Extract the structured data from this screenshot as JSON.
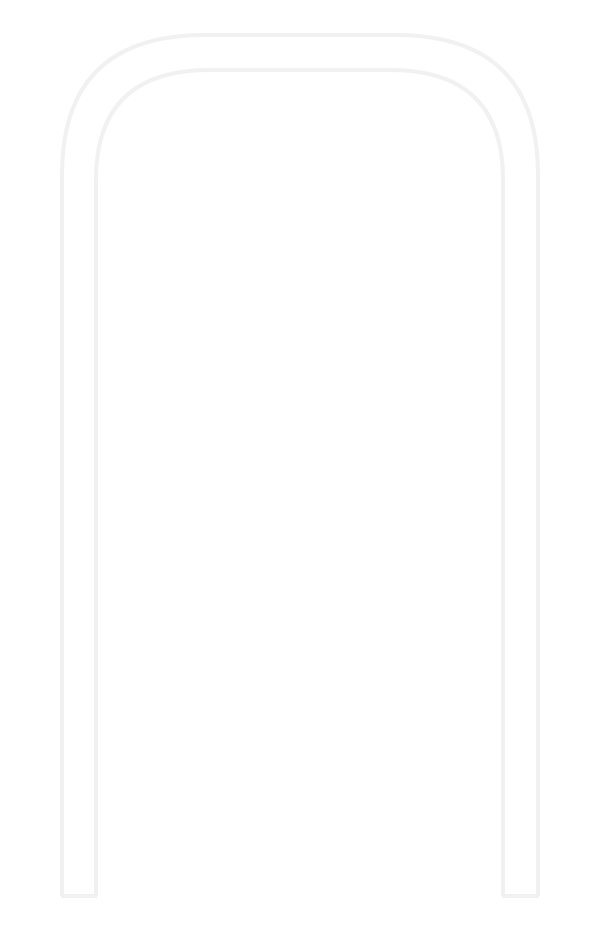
{
  "colors": {
    "background": "#ffffff",
    "outline": "#f1f1f1",
    "inner_fill": "#ffffff"
  }
}
